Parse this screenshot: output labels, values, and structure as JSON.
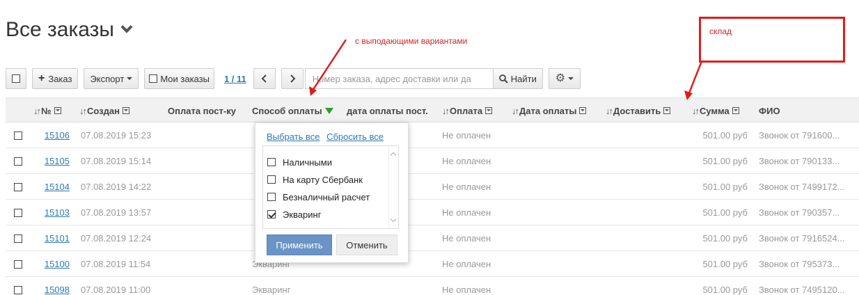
{
  "page": {
    "title": "Все заказы"
  },
  "toolbar": {
    "add_label": "Заказ",
    "export_label": "Экспорт",
    "my_orders_label": "Мои заказы",
    "pager": "1 / 11",
    "search_placeholder": "Номер заказа, адрес доставки или да",
    "search_button": "Найти"
  },
  "columns": {
    "number": "№",
    "created": "Создан",
    "payment_post": "Оплата пост-ку",
    "payment_method": "Способ оплаты",
    "payment_date_post": "дата оплаты пост.",
    "payment": "Оплата",
    "payment_date": "Дата оплаты",
    "delivery": "Доставить",
    "sum": "Сумма",
    "fio": "ФИО"
  },
  "rows": [
    {
      "id": "15106",
      "created": "07.08.2019 15:23",
      "method": "",
      "payment": "Не оплачен",
      "sum": "501.00 руб",
      "fio": "Звонок от 791600..."
    },
    {
      "id": "15105",
      "created": "07.08.2019 15:14",
      "method": "",
      "payment": "Не оплачен",
      "sum": "501.00 руб",
      "fio": "Звонок от 790133..."
    },
    {
      "id": "15104",
      "created": "07.08.2019 14:22",
      "method": "",
      "payment": "Не оплачен",
      "sum": "501.00 руб",
      "fio": "Звонок от 7499172..."
    },
    {
      "id": "15103",
      "created": "07.08.2019 13:57",
      "method": "",
      "payment": "Не оплачен",
      "sum": "501.00 руб",
      "fio": "Звонок от 790357..."
    },
    {
      "id": "15101",
      "created": "07.08.2019 12:24",
      "method": "",
      "payment": "Не оплачен",
      "sum": "501.00 руб",
      "fio": "Звонок от 7916524..."
    },
    {
      "id": "15100",
      "created": "07.08.2019 11:54",
      "method": "Экваринг",
      "payment": "Не оплачен",
      "sum": "501.00 руб",
      "fio": "Звонок от 795373..."
    },
    {
      "id": "15098",
      "created": "07.08.2019 11:00",
      "method": "Экваринг",
      "payment": "Не оплачен",
      "sum": "501.00 руб",
      "fio": "Звонок от 7495120..."
    }
  ],
  "filter_dropdown": {
    "select_all": "Выбрать все",
    "reset_all": "Сбросить все",
    "options": [
      {
        "label": "Наличными",
        "checked": false
      },
      {
        "label": "На карту Сбербанк",
        "checked": false
      },
      {
        "label": "Безналичный расчет",
        "checked": false
      },
      {
        "label": "Экваринг",
        "checked": true
      }
    ],
    "apply": "Применить",
    "cancel": "Отменить"
  },
  "annotations": {
    "dropdown_note": "с выподающими вариантами",
    "box_note": "склад",
    "color": "#e21b1b"
  },
  "icons": {
    "title_chevron": "chevron-down-icon",
    "add": "plus-icon",
    "search": "search-icon",
    "settings": "gear-icon",
    "prev": "chevron-left-icon",
    "next": "chevron-right-icon",
    "filter_active": "filter-active-icon"
  }
}
